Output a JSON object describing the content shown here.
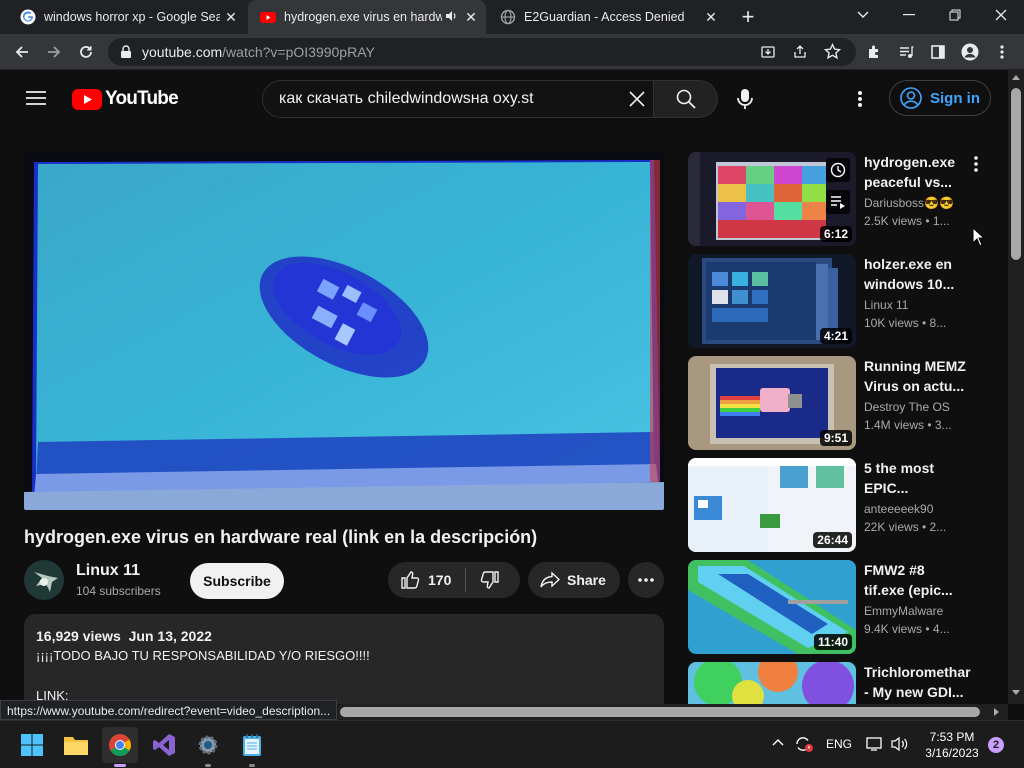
{
  "browser": {
    "tabs": [
      {
        "title": "windows horror xp - Google Sear",
        "icon": "google-icon"
      },
      {
        "title": "hydrogen.exe virus en hardw",
        "icon": "youtube-icon",
        "audio": true
      },
      {
        "title": "E2Guardian - Access Denied",
        "icon": "globe-icon"
      }
    ],
    "url_host": "youtube.com",
    "url_path": "/watch?v=pOI3990pRAY"
  },
  "youtube": {
    "logo_text": "YouTube",
    "search_value": "как скачать chiledwindowsна oxy.st",
    "signin_label": "Sign in"
  },
  "video": {
    "title": "hydrogen.exe virus en hardware real (link en la descripción)",
    "channel": "Linux 11",
    "subscribers": "104 subscribers",
    "subscribe_label": "Subscribe",
    "likes": "170",
    "share_label": "Share",
    "views": "16,929 views",
    "date": "Jun 13, 2022",
    "desc_line1": "¡¡¡¡TODO BAJO TU RESPONSABILIDAD Y/O RIESGO!!!!",
    "desc_line2": "LINK:"
  },
  "related": [
    {
      "title": "hydrogen.exe peaceful vs...",
      "channel": "Dariusboss😎😎",
      "meta": "2.5K views  • 1...",
      "duration": "6:12"
    },
    {
      "title": "holzer.exe en windows 10...",
      "channel": "Linux 11",
      "meta": "10K views  • 8...",
      "duration": "4:21"
    },
    {
      "title": "Running MEMZ Virus on actu...",
      "channel": "Destroy The OS",
      "meta": "1.4M views  • 3...",
      "duration": "9:51"
    },
    {
      "title": "5 the most EPIC...",
      "channel": "anteeeeek90",
      "meta": "22K views  • 2...",
      "duration": "26:44"
    },
    {
      "title": "FMW2 #8 tif.exe (epic...",
      "channel": "EmmyMalware",
      "meta": "9.4K views  • 4...",
      "duration": "11:40"
    },
    {
      "title": "Trichloromethar - My new GDI...",
      "channel": "",
      "meta": "",
      "duration": ""
    }
  ],
  "status_url": "https://www.youtube.com/redirect?event=video_description...",
  "taskbar": {
    "lang": "ENG",
    "time": "7:53 PM",
    "date": "3/16/2023",
    "notifications": "2"
  }
}
